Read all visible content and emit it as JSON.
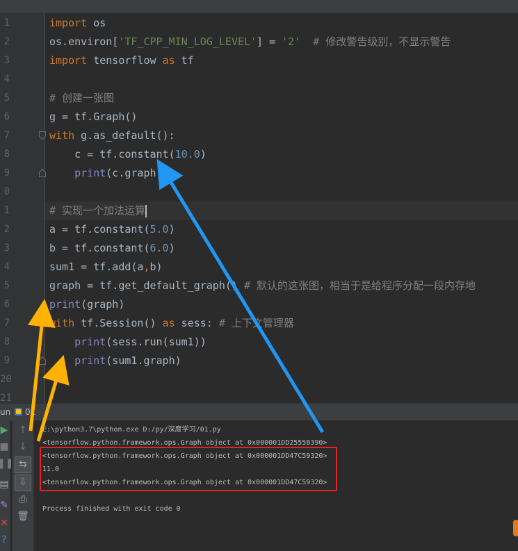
{
  "editor": {
    "line_numbers": [
      "1",
      "2",
      "3",
      "4",
      "5",
      "6",
      "7",
      "8",
      "9",
      "0",
      "1",
      "2",
      "3",
      "4",
      "5",
      "6",
      "7",
      "8",
      "9",
      "20",
      "21"
    ],
    "lines": [
      [
        {
          "t": "import",
          "c": "kw"
        },
        {
          "t": " os",
          "c": ""
        }
      ],
      [
        {
          "t": "os.environ[",
          "c": ""
        },
        {
          "t": "'TF_CPP_MIN_LOG_LEVEL'",
          "c": "str"
        },
        {
          "t": "] = ",
          "c": ""
        },
        {
          "t": "'2'",
          "c": "str"
        },
        {
          "t": "  # 修改警告级别，不显示警告",
          "c": "cmt"
        }
      ],
      [
        {
          "t": "import",
          "c": "kw"
        },
        {
          "t": " tensorflow ",
          "c": ""
        },
        {
          "t": "as",
          "c": "kw"
        },
        {
          "t": " tf",
          "c": ""
        }
      ],
      [],
      [
        {
          "t": "# 创建一张图",
          "c": "cmt"
        }
      ],
      [
        {
          "t": "g = tf.Graph()",
          "c": ""
        }
      ],
      [
        {
          "t": "with",
          "c": "kw"
        },
        {
          "t": " g.as_default():",
          "c": ""
        }
      ],
      [
        {
          "t": "    c = tf.constant(",
          "c": ""
        },
        {
          "t": "10.0",
          "c": "num"
        },
        {
          "t": ")",
          "c": ""
        }
      ],
      [
        {
          "t": "    ",
          "c": ""
        },
        {
          "t": "print",
          "c": "fn"
        },
        {
          "t": "(c.graph)",
          "c": ""
        }
      ],
      [],
      [
        {
          "t": "# 实现一个加法运算",
          "c": "cmt"
        }
      ],
      [
        {
          "t": "a = tf.constant(",
          "c": ""
        },
        {
          "t": "5.0",
          "c": "num"
        },
        {
          "t": ")",
          "c": ""
        }
      ],
      [
        {
          "t": "b = tf.constant(",
          "c": ""
        },
        {
          "t": "6.0",
          "c": "num"
        },
        {
          "t": ")",
          "c": ""
        }
      ],
      [
        {
          "t": "sum1 = tf.add(a",
          "c": ""
        },
        {
          "t": ",",
          "c": "kw"
        },
        {
          "t": "b)",
          "c": ""
        }
      ],
      [
        {
          "t": "graph = tf.get_default_graph() ",
          "c": ""
        },
        {
          "t": "# 默认的这张图，相当于是给程序分配一段内存地",
          "c": "cmt"
        }
      ],
      [
        {
          "t": "print",
          "c": "fn"
        },
        {
          "t": "(graph)",
          "c": ""
        }
      ],
      [
        {
          "t": "with",
          "c": "kw"
        },
        {
          "t": " tf.Session() ",
          "c": ""
        },
        {
          "t": "as",
          "c": "kw"
        },
        {
          "t": " sess: ",
          "c": ""
        },
        {
          "t": "# 上下文管理器",
          "c": "cmt"
        }
      ],
      [
        {
          "t": "    ",
          "c": ""
        },
        {
          "t": "print",
          "c": "fn"
        },
        {
          "t": "(sess.run(sum1))",
          "c": ""
        }
      ],
      [
        {
          "t": "    ",
          "c": ""
        },
        {
          "t": "print",
          "c": "fn"
        },
        {
          "t": "(sum1.graph)",
          "c": ""
        }
      ],
      [],
      []
    ],
    "current_line": 10
  },
  "run_panel": {
    "label": "un",
    "tab_name": "01"
  },
  "console": {
    "lines": [
      "E:\\python3.7\\python.exe D:/py/深度学习/01.py",
      "<tensorflow.python.framework.ops.Graph object at 0x000001DD25558390>",
      "<tensorflow.python.framework.ops.Graph object at 0x000001DD47C59320>",
      "11.0",
      "<tensorflow.python.framework.ops.Graph object at 0x000001DD47C59320>",
      "",
      "Process finished with exit code 0"
    ]
  },
  "colors": {
    "background": "#2b2b2b",
    "keyword": "#cc7832",
    "string": "#6a8759",
    "number": "#6897bb",
    "comment": "#808080",
    "builtin": "#8888c6",
    "annotation_red": "#e22424",
    "annotation_blue": "#2196f3",
    "annotation_yellow": "#ffb300"
  }
}
